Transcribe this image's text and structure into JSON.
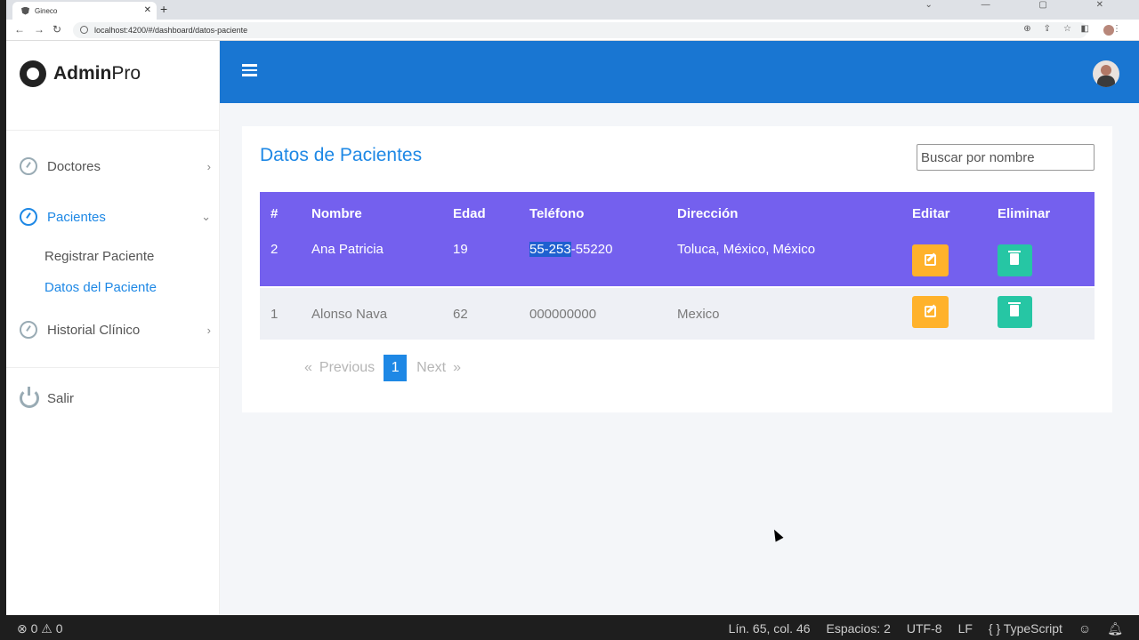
{
  "browser": {
    "tab_title": "Gineco",
    "url": "localhost:4200/#/dashboard/datos-paciente",
    "tab_close": "✕",
    "new_tab": "+",
    "window_controls": "⌄ — ▢ ✕"
  },
  "sidebar": {
    "logo_bold": "Admin",
    "logo_light": "Pro",
    "items": [
      {
        "label": "Doctores",
        "chevron": "›"
      },
      {
        "label": "Pacientes",
        "chevron": "⌄"
      },
      {
        "label": "Historial Clínico",
        "chevron": "›"
      }
    ],
    "sub_items": [
      {
        "label": "Registrar Paciente"
      },
      {
        "label": "Datos del Paciente"
      }
    ],
    "logout": "Salir"
  },
  "main": {
    "title": "Datos de Pacientes",
    "search_placeholder": "Buscar por nombre",
    "table": {
      "headers": [
        "#",
        "Nombre",
        "Edad",
        "Teléfono",
        "Dirección",
        "Editar",
        "Eliminar"
      ],
      "rows": [
        {
          "id": "2",
          "nombre": "Ana Patricia",
          "edad": "19",
          "telefono_sel": "55-253",
          "telefono_rest": "-55220",
          "direccion": "Toluca, México, México"
        },
        {
          "id": "1",
          "nombre": "Alonso Nava",
          "edad": "62",
          "telefono": "000000000",
          "direccion": "Mexico"
        }
      ]
    },
    "pager": {
      "prev_arrow": "«",
      "previous": "Previous",
      "current": "1",
      "next": "Next",
      "next_arrow": "»"
    }
  },
  "statusbar": {
    "problems": "⊗ 0 ⚠ 0",
    "position": "Lín. 65, col. 46",
    "spaces": "Espacios: 2",
    "encoding": "UTF-8",
    "eol": "LF",
    "language": "{ } TypeScript"
  },
  "colors": {
    "topbar": "#1976d2",
    "table_header": "#7460ee",
    "accent": "#1e88e5",
    "edit": "#ffb22b",
    "delete": "#26c6a4"
  }
}
